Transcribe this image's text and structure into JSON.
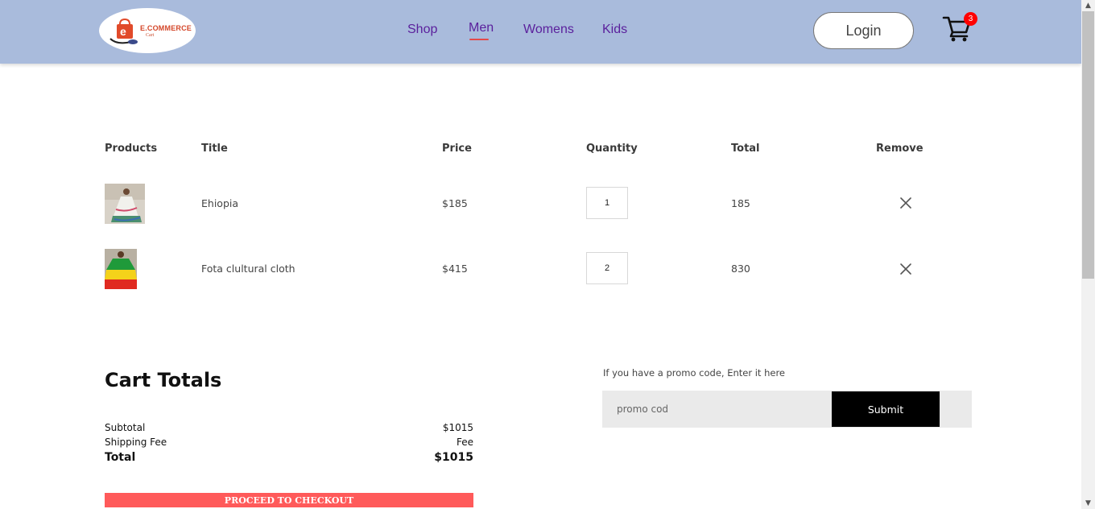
{
  "navbar": {
    "logo": {
      "title": "E.COMMERCE",
      "subtitle": "Cart"
    },
    "links": [
      {
        "label": "Shop",
        "active": false
      },
      {
        "label": "Men",
        "active": true
      },
      {
        "label": "Womens",
        "active": false
      },
      {
        "label": "Kids",
        "active": false
      }
    ],
    "login_label": "Login",
    "cart_count": "3",
    "accent_color": "#e34a4a",
    "background_color": "#a9bbdc"
  },
  "cart": {
    "headers": {
      "products": "Products",
      "title": "Title",
      "price": "Price",
      "quantity": "Quantity",
      "total": "Total",
      "remove": "Remove"
    },
    "items": [
      {
        "image_icon": "ethiopian-dress-photo",
        "title": "Ehiopia",
        "price": "$185",
        "quantity": "1",
        "total": "185",
        "remove_icon": "close-icon"
      },
      {
        "image_icon": "cultural-cloth-photo",
        "title": "Fota clultural cloth",
        "price": "$415",
        "quantity": "2",
        "total": "830",
        "remove_icon": "close-icon"
      }
    ]
  },
  "totals": {
    "title": "Cart Totals",
    "subtotal_label": "Subtotal",
    "subtotal_value": "$1015",
    "shipping_label": "Shipping Fee",
    "shipping_value": "Fee",
    "total_label": "Total",
    "total_value": "$1015",
    "checkout_label": "PROCEED TO CHECKOUT",
    "checkout_color": "#ff5a5a"
  },
  "promo": {
    "label": "If you have a promo code, Enter it here",
    "placeholder": "promo cod",
    "value": "",
    "submit_label": "Submit"
  }
}
